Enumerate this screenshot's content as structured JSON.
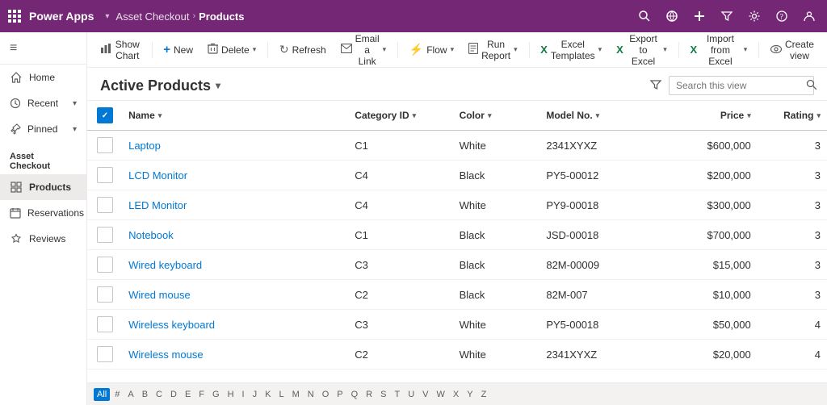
{
  "topbar": {
    "logo": "Power Apps",
    "logo_chevron": "▾",
    "app_name": "Asset Checkout",
    "breadcrumbs": [
      {
        "label": "Asset Checkout",
        "active": false
      },
      {
        "label": "Products",
        "active": true
      }
    ],
    "icons": [
      "search",
      "question-mark",
      "heart",
      "plus",
      "funnel",
      "settings",
      "help",
      "user"
    ]
  },
  "sidebar": {
    "toggle_icon": "≡",
    "home_label": "Home",
    "recent_label": "Recent",
    "pinned_label": "Pinned",
    "section_label": "Asset Checkout",
    "items": [
      {
        "label": "Products",
        "active": true
      },
      {
        "label": "Reservations",
        "active": false
      },
      {
        "label": "Reviews",
        "active": false
      }
    ]
  },
  "commandbar": {
    "buttons": [
      {
        "id": "show-chart",
        "icon": "📊",
        "label": "Show Chart"
      },
      {
        "id": "new",
        "icon": "+",
        "label": "New"
      },
      {
        "id": "delete",
        "icon": "🗑",
        "label": "Delete",
        "has_chevron": true
      },
      {
        "id": "refresh",
        "icon": "↻",
        "label": "Refresh"
      },
      {
        "id": "email-link",
        "icon": "✉",
        "label": "Email a Link",
        "has_chevron": true
      },
      {
        "id": "flow",
        "icon": "⚡",
        "label": "Flow",
        "has_chevron": true
      },
      {
        "id": "run-report",
        "icon": "📄",
        "label": "Run Report",
        "has_chevron": true
      },
      {
        "id": "excel-templates",
        "icon": "🟩",
        "label": "Excel Templates",
        "has_chevron": true
      },
      {
        "id": "export-excel",
        "icon": "📤",
        "label": "Export to Excel",
        "has_chevron": true
      },
      {
        "id": "import-excel",
        "icon": "📥",
        "label": "Import from Excel",
        "has_chevron": true
      },
      {
        "id": "create-view",
        "icon": "👁",
        "label": "Create view"
      }
    ]
  },
  "view": {
    "title": "Active Products",
    "search_placeholder": "Search this view"
  },
  "table": {
    "columns": [
      {
        "id": "check",
        "label": ""
      },
      {
        "id": "name",
        "label": "Name"
      },
      {
        "id": "category",
        "label": "Category ID"
      },
      {
        "id": "color",
        "label": "Color"
      },
      {
        "id": "model",
        "label": "Model No."
      },
      {
        "id": "price",
        "label": "Price"
      },
      {
        "id": "rating",
        "label": "Rating"
      }
    ],
    "rows": [
      {
        "name": "Laptop",
        "category": "C1",
        "color": "White",
        "model": "2341XYXZ",
        "price": "$600,000",
        "rating": "3"
      },
      {
        "name": "LCD Monitor",
        "category": "C4",
        "color": "Black",
        "model": "PY5-00012",
        "price": "$200,000",
        "rating": "3"
      },
      {
        "name": "LED Monitor",
        "category": "C4",
        "color": "White",
        "model": "PY9-00018",
        "price": "$300,000",
        "rating": "3"
      },
      {
        "name": "Notebook",
        "category": "C1",
        "color": "Black",
        "model": "JSD-00018",
        "price": "$700,000",
        "rating": "3"
      },
      {
        "name": "Wired keyboard",
        "category": "C3",
        "color": "Black",
        "model": "82M-00009",
        "price": "$15,000",
        "rating": "3"
      },
      {
        "name": "Wired mouse",
        "category": "C2",
        "color": "Black",
        "model": "82M-007",
        "price": "$10,000",
        "rating": "3"
      },
      {
        "name": "Wireless keyboard",
        "category": "C3",
        "color": "White",
        "model": "PY5-00018",
        "price": "$50,000",
        "rating": "4"
      },
      {
        "name": "Wireless mouse",
        "category": "C2",
        "color": "White",
        "model": "2341XYXZ",
        "price": "$20,000",
        "rating": "4"
      }
    ]
  },
  "alphabet": [
    "All",
    "#",
    "A",
    "B",
    "C",
    "D",
    "E",
    "F",
    "G",
    "H",
    "I",
    "J",
    "K",
    "L",
    "M",
    "N",
    "O",
    "P",
    "Q",
    "R",
    "S",
    "T",
    "U",
    "V",
    "W",
    "X",
    "Y",
    "Z"
  ]
}
